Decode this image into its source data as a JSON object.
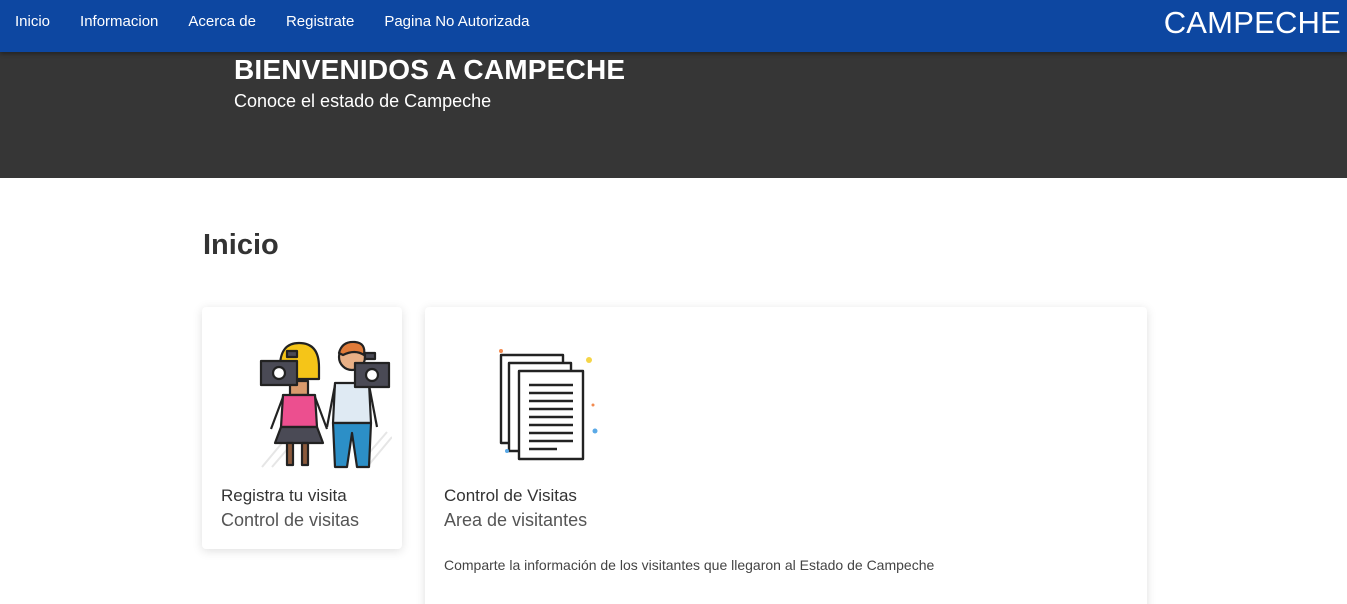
{
  "navbar": {
    "links": [
      "Inicio",
      "Informacion",
      "Acerca de",
      "Registrate",
      "Pagina No Autorizada"
    ],
    "brand": "CAMPECHE"
  },
  "hero": {
    "title": "BIENVENIDOS A CAMPECHE",
    "subtitle": "Conoce el estado de Campeche"
  },
  "main": {
    "section_title": "Inicio",
    "cards": [
      {
        "image": "tourists-with-cameras-illustration",
        "title": "Registra tu visita",
        "subtitle": "Control de visitas"
      },
      {
        "image": "documents-stack-illustration",
        "title": "Control de Visitas",
        "subtitle": "Area de visitantes",
        "description": "Comparte la información de los visitantes que llegaron al Estado de Campeche"
      }
    ]
  },
  "colors": {
    "navbar": "#0d47a1",
    "hero": "#363636",
    "background": "#ffffff"
  }
}
